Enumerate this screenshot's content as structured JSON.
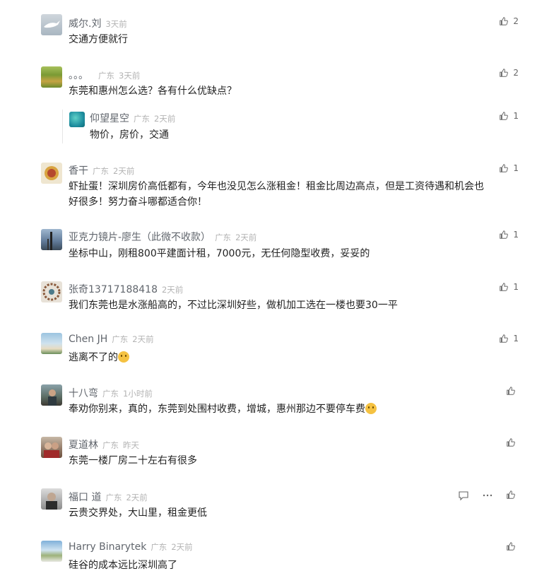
{
  "comments": [
    {
      "name": "威尔.刘",
      "location": "",
      "time": "3天前",
      "text": "交通方便就行",
      "likes": "2"
    },
    {
      "name": "。。。",
      "location": "广东",
      "time": "3天前",
      "text": "东莞和惠州怎么选？各有什么优缺点？",
      "likes": "2"
    },
    {
      "name": "仰望星空",
      "location": "广东",
      "time": "2天前",
      "text": "物价，房价，交通",
      "likes": "1"
    },
    {
      "name": "香干",
      "location": "广东",
      "time": "2天前",
      "text_line1": "虾扯蛋！深圳房价高低都有，今年也没见怎么涨租金！租金比周边高点，但是工资待遇和机会也",
      "text_line2": "好很多！努力奋斗哪都适合你！",
      "likes": "1"
    },
    {
      "name": "亚克力镜片-廖生（此微不收款）",
      "location": "广东",
      "time": "2天前",
      "text": "坐标中山，刚租800平建面计租，7000元，无任何隐型收费，妥妥的",
      "likes": "1"
    },
    {
      "name": "张奇13717188418",
      "location": "",
      "time": "2天前",
      "text": "我们东莞也是水涨船高的，不过比深圳好些，做机加工选在一楼也要30一平",
      "likes": "1"
    },
    {
      "name": "Chen JH",
      "location": "广东",
      "time": "2天前",
      "text": "逃离不了的",
      "likes": "1"
    },
    {
      "name": "十八弯",
      "location": "广东",
      "time": "1小时前",
      "text": "奉劝你别来，真的，东莞到处围村收费，增城，惠州那边不要停车费",
      "likes": ""
    },
    {
      "name": "夏道林",
      "location": "广东",
      "time": "昨天",
      "text": "东莞一楼厂房二十左右有很多",
      "likes": ""
    },
    {
      "name": "福口 道",
      "location": "广东",
      "time": "2天前",
      "text": "云贵交界处，大山里，租金更低",
      "likes": ""
    },
    {
      "name": "Harry Binarytek",
      "location": "广东",
      "time": "2天前",
      "text": "硅谷的成本远比深圳高了",
      "likes": ""
    }
  ],
  "colors": {
    "name": "#61666d",
    "meta": "#b3b3b3",
    "text": "#222222",
    "icon": "#666666"
  },
  "icons": {
    "like": "thumbs-up-icon",
    "reply": "comment-icon",
    "more": "more-icon"
  }
}
